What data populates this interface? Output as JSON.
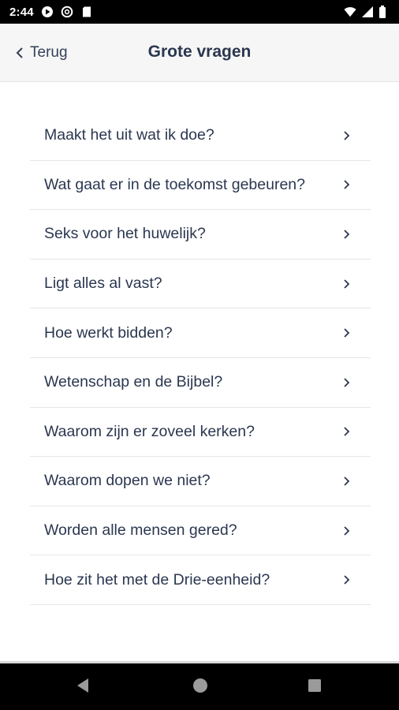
{
  "status_bar": {
    "time": "2:44",
    "icons_left": [
      "play-icon",
      "data-saver-icon",
      "sd-card-icon"
    ],
    "icons_right": [
      "wifi-icon",
      "signal-icon",
      "battery-icon"
    ]
  },
  "header": {
    "back_label": "Terug",
    "title": "Grote vragen"
  },
  "questions": [
    "Maakt het uit wat ik doe?",
    "Wat gaat er in de toekomst gebeuren?",
    "Seks voor het huwelijk?",
    "Ligt alles al vast?",
    "Hoe werkt bidden?",
    "Wetenschap en de Bijbel?",
    "Waarom zijn er zoveel kerken?",
    "Waarom dopen we niet?",
    "Worden alle mensen gered?",
    "Hoe zit het met de Drie-eenheid?"
  ],
  "nav_bar": {
    "buttons": [
      "back-triangle-icon",
      "home-circle-icon",
      "recents-square-icon"
    ]
  },
  "colors": {
    "text": "#2b3750",
    "header_bg": "#f6f6f6",
    "divider": "#e6e6e6"
  }
}
